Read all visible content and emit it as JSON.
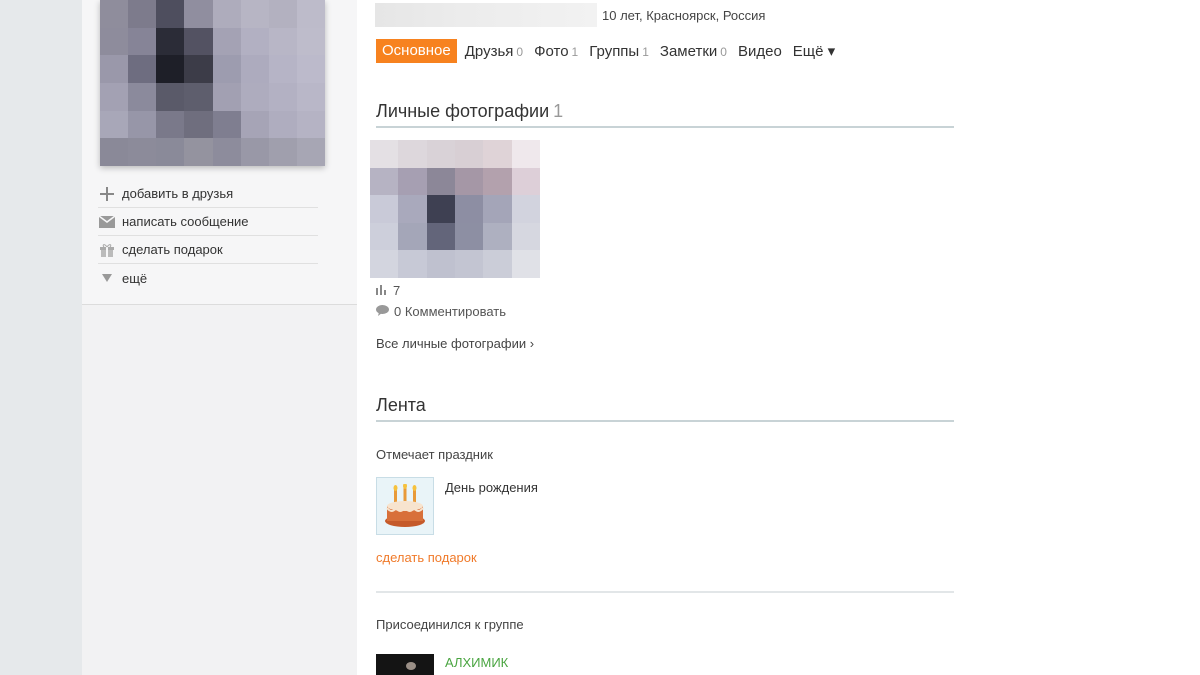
{
  "sidebar": {
    "actions": [
      {
        "icon": "plus-icon",
        "label": "добавить в друзья"
      },
      {
        "icon": "envelope-icon",
        "label": "написать сообщение"
      },
      {
        "icon": "gift-icon",
        "label": "сделать подарок"
      },
      {
        "icon": "triangle-down-icon",
        "label": "ещё"
      }
    ]
  },
  "profile": {
    "meta": "10 лет, Красноярск, Россия"
  },
  "tabs": [
    {
      "label": "Основное",
      "count": ""
    },
    {
      "label": "Друзья",
      "count": "0"
    },
    {
      "label": "Фото",
      "count": "1"
    },
    {
      "label": "Группы",
      "count": "1"
    },
    {
      "label": "Заметки",
      "count": "0"
    },
    {
      "label": "Видео",
      "count": ""
    },
    {
      "label": "Ещё ▾",
      "count": ""
    }
  ],
  "photos_section": {
    "title": "Личные фотографии",
    "count": "1",
    "likes": "7",
    "comments": "0 Комментировать",
    "all_link": "Все личные фотографии ›"
  },
  "feed": {
    "title": "Лента",
    "item1": {
      "label": "Отмечает праздник",
      "title": "День рождения",
      "gift_link": "сделать подарок"
    },
    "item2": {
      "label": "Присоединился к группе",
      "group_name": "АЛХИМИК"
    }
  },
  "colors": {
    "accent": "#f7821f",
    "gift_link": "#f07a2a",
    "group_link": "#4aa541",
    "section_rule": "#c8d3d6"
  }
}
